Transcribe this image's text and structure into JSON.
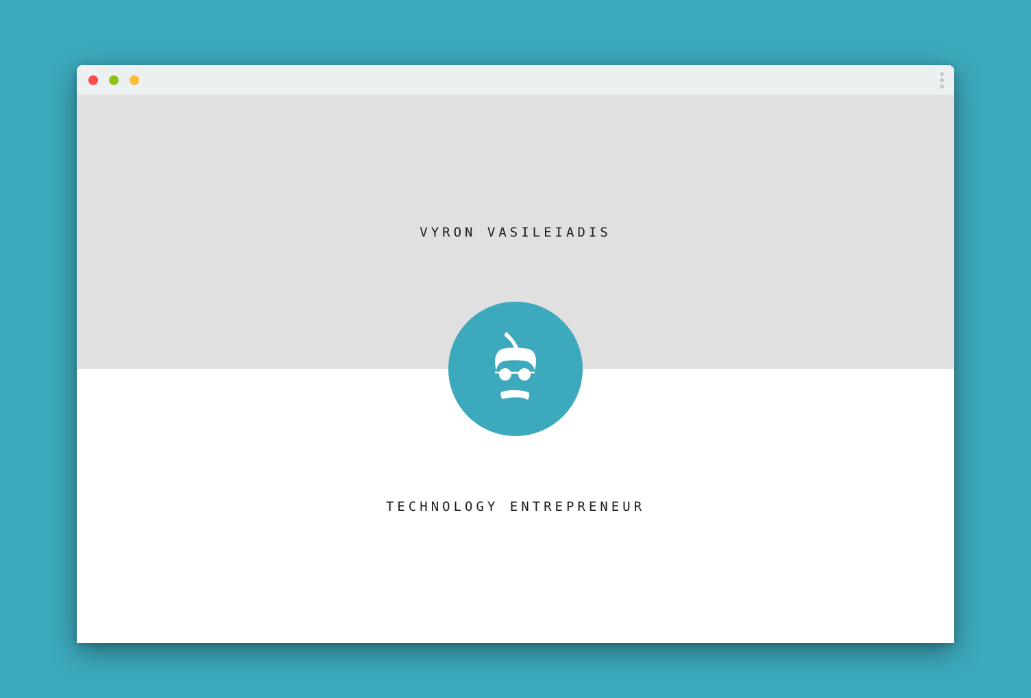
{
  "window": {
    "controls": [
      "close",
      "minimize",
      "maximize"
    ],
    "menu_icon": "more-vertical-icon"
  },
  "hero": {
    "name": "VYRON VASILEIADIS",
    "avatar_icon": "face-glasses-mustache-icon"
  },
  "about": {
    "tagline": "TECHNOLOGY ENTREPRENEUR"
  },
  "colors": {
    "background": "#3ca9bc",
    "accent": "#3ca9bc",
    "hero_bg": "#e0e0e0",
    "titlebar_bg": "#edf0f1",
    "close": "#fd4a4a",
    "minimize": "#8ec311",
    "maximize": "#fdbd3b"
  }
}
